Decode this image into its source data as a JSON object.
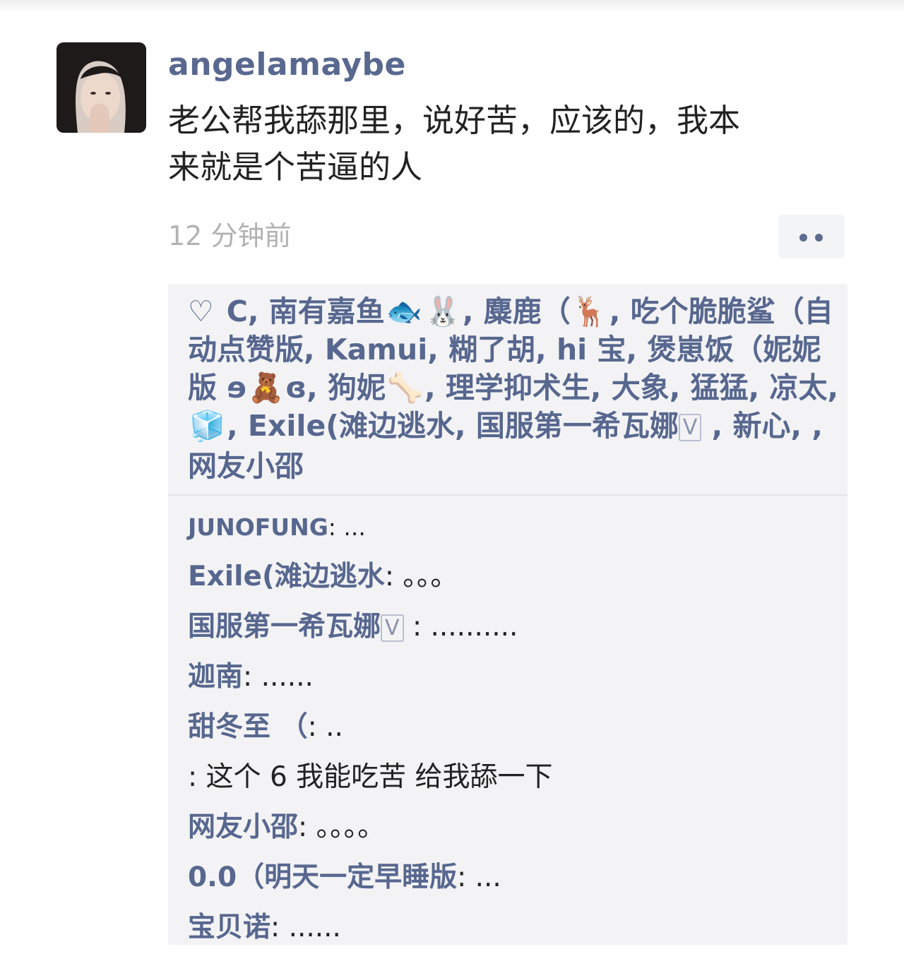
{
  "post": {
    "username": "angelamaybe",
    "text_line1": "老公帮我舔那里，说好苦，应该的，我本",
    "text_line2": "来就是个苦逼的人",
    "time": "12 分钟前"
  },
  "likes": {
    "parts": {
      "a": "C, 南有嘉鱼",
      "b": ", 麋鹿（",
      "c": ", 吃个脆脆鲨（自动点赞版, Kamui, 糊了胡, hi 宝, 煲崽饭（妮妮版 ɘ",
      "d": "ɞ, 狗妮",
      "e": ", 理学抑术生, 大象, 猛猛, 凉太, ",
      "f": ", Exile(滩边逃水, 国服第一希瓦娜",
      "g": " , 新心, , 网友小邵"
    },
    "v_badge": "V",
    "emojis": {
      "fish": "🐟",
      "rabbit": "🐰",
      "deer": "🦌",
      "bear": "🧸",
      "bone": "🦴",
      "ice": "🧊"
    }
  },
  "comments": [
    {
      "author": "JUNOFUNG",
      "sep": ": ",
      "text": "..."
    },
    {
      "author": "Exile(滩边逃水",
      "sep": ": ",
      "text": "。。。"
    },
    {
      "author": "国服第一希瓦娜",
      "sep": " : ",
      "text": ".........."
    },
    {
      "author": "迦南",
      "sep": ": ",
      "text": "......"
    },
    {
      "author": "甜冬至 （",
      "sep": ": ",
      "text": ".."
    },
    {
      "author": "",
      "sep": ": ",
      "text": "这个 6 我能吃苦 给我舔一下"
    },
    {
      "author": "网友小邵",
      "sep": ": ",
      "text": "。。。。"
    },
    {
      "author": "0.0（明天一定早睡版",
      "sep": ": ",
      "text": "..."
    },
    {
      "author": "宝贝诺",
      "sep": ": ",
      "text": "......"
    }
  ],
  "icons": {
    "more": "more-dots-icon",
    "heart": "heart-outline-icon"
  },
  "colors": {
    "accent": "#57678f",
    "time": "#b2b2b2",
    "panel": "#f3f3f5"
  }
}
